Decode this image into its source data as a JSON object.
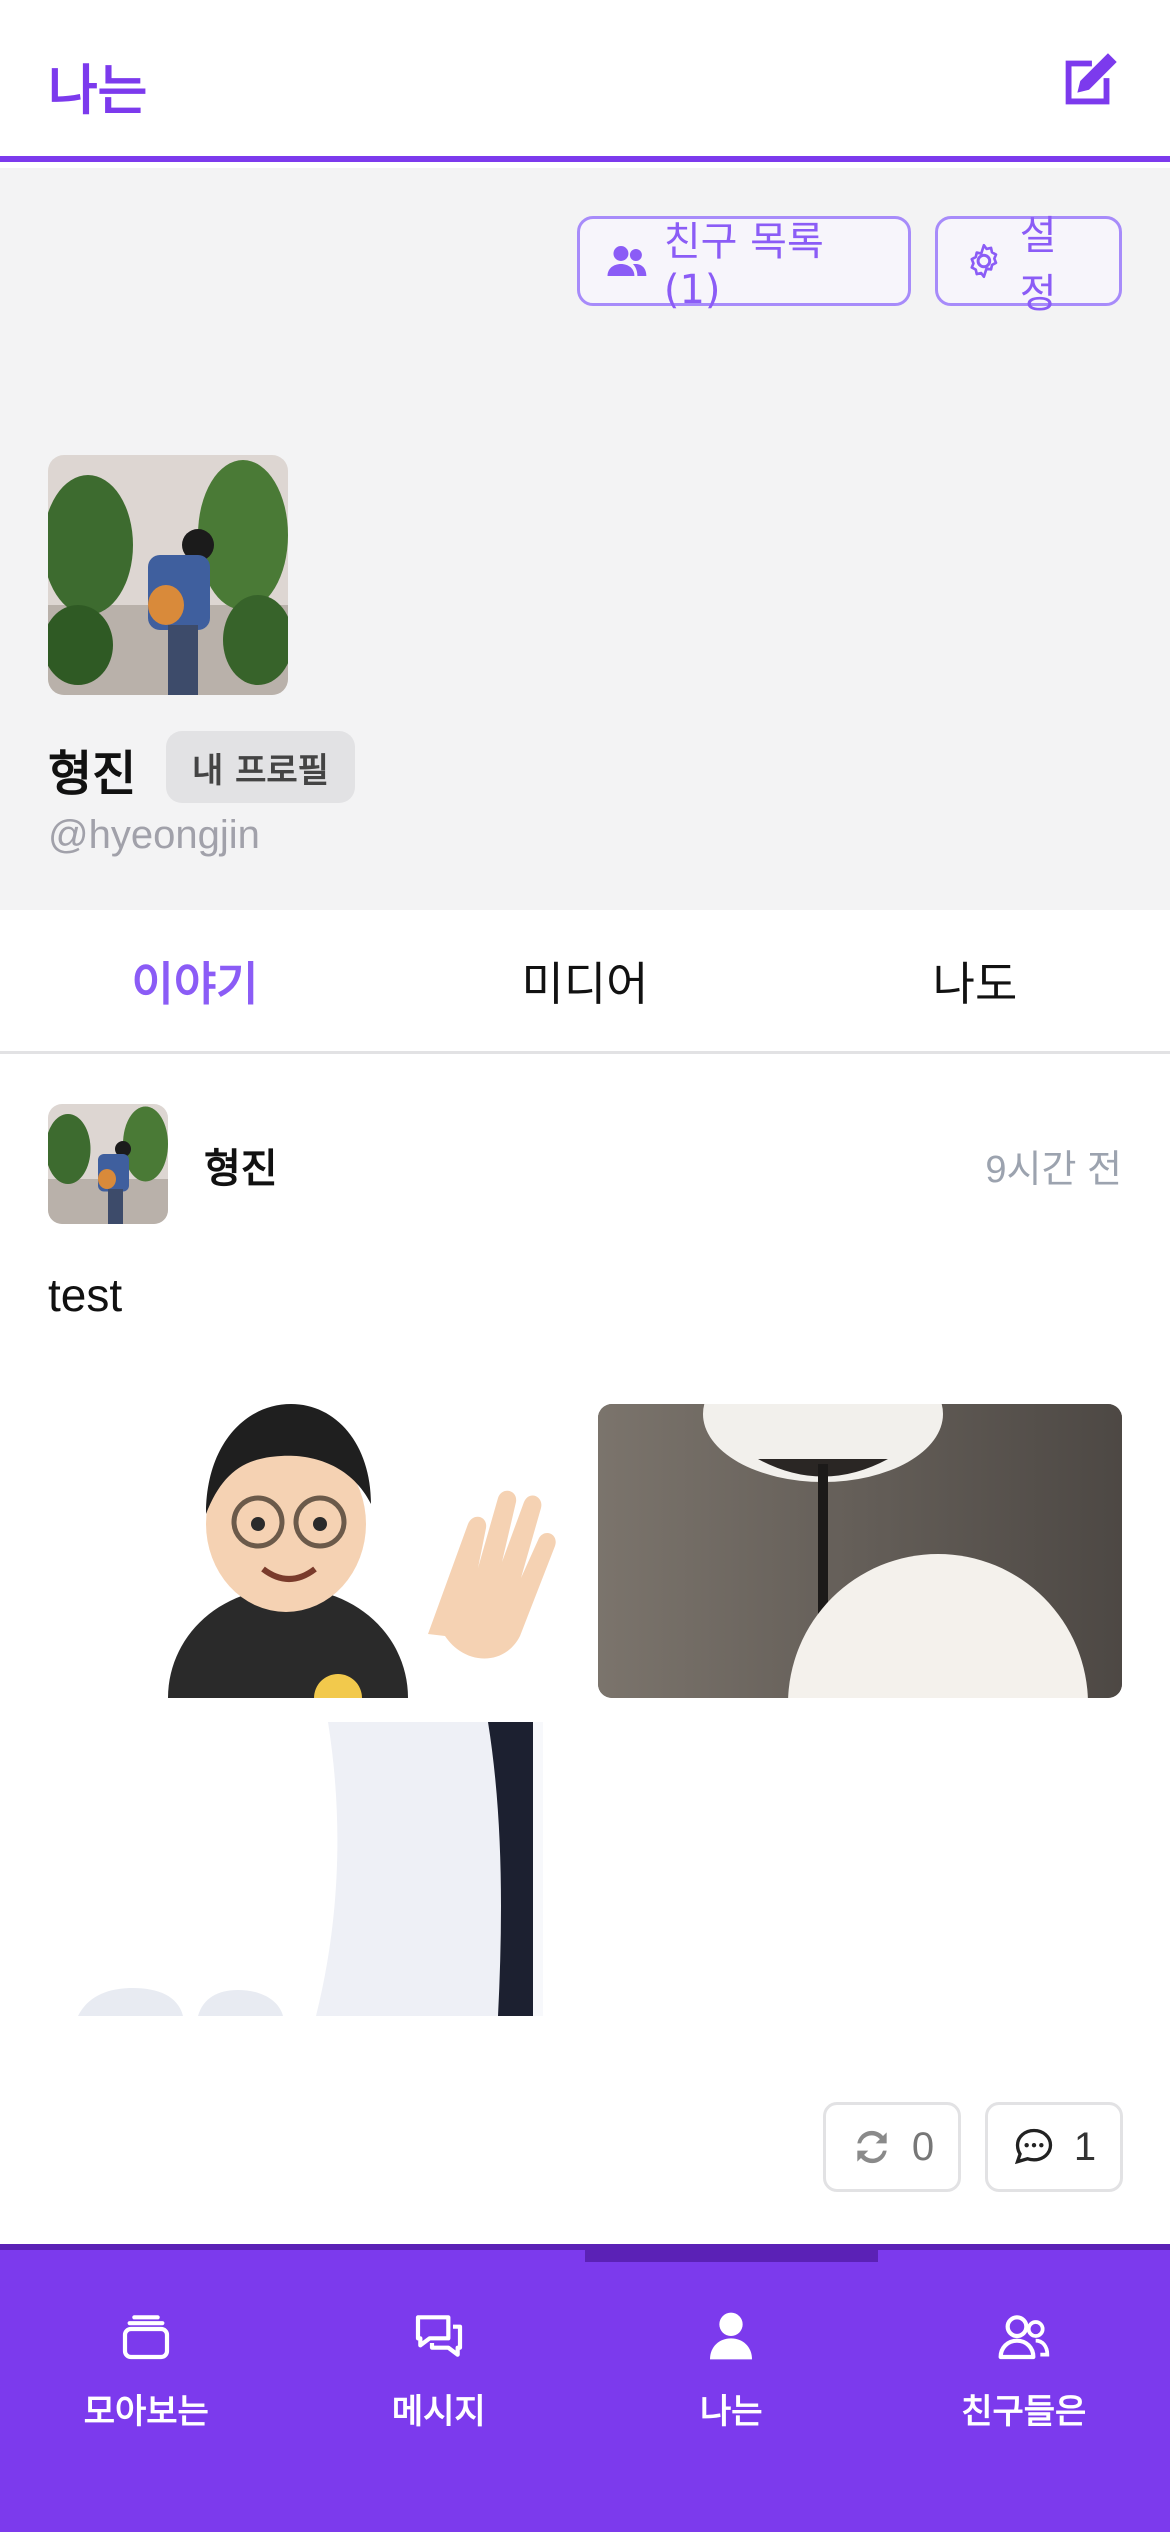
{
  "header": {
    "title": "나는",
    "compose_icon": "pencil-square-icon"
  },
  "profile": {
    "friends_button": {
      "icon": "users-icon",
      "label": "친구 목록 (1)"
    },
    "settings_button": {
      "icon": "gear-icon",
      "label": "설정"
    },
    "name": "형진",
    "badge": "내 프로필",
    "handle": "@hyeongjin"
  },
  "tabs": [
    {
      "label": "이야기",
      "active": true
    },
    {
      "label": "미디어",
      "active": false
    },
    {
      "label": "나도",
      "active": false
    }
  ],
  "post": {
    "author": "형진",
    "time": "9시간 전",
    "text": "test",
    "media_count": 3,
    "repost_count": "0",
    "comment_count": "1"
  },
  "bottom_nav": [
    {
      "label": "모아보는",
      "icon": "cards-icon",
      "active": false
    },
    {
      "label": "메시지",
      "icon": "chat-bubbles-icon",
      "active": false
    },
    {
      "label": "나는",
      "icon": "person-icon",
      "active": true
    },
    {
      "label": "친구들은",
      "icon": "users-icon",
      "active": false
    }
  ],
  "colors": {
    "accent": "#7c3aed",
    "accent_light": "#a78bfa",
    "muted": "#9ca3af"
  }
}
